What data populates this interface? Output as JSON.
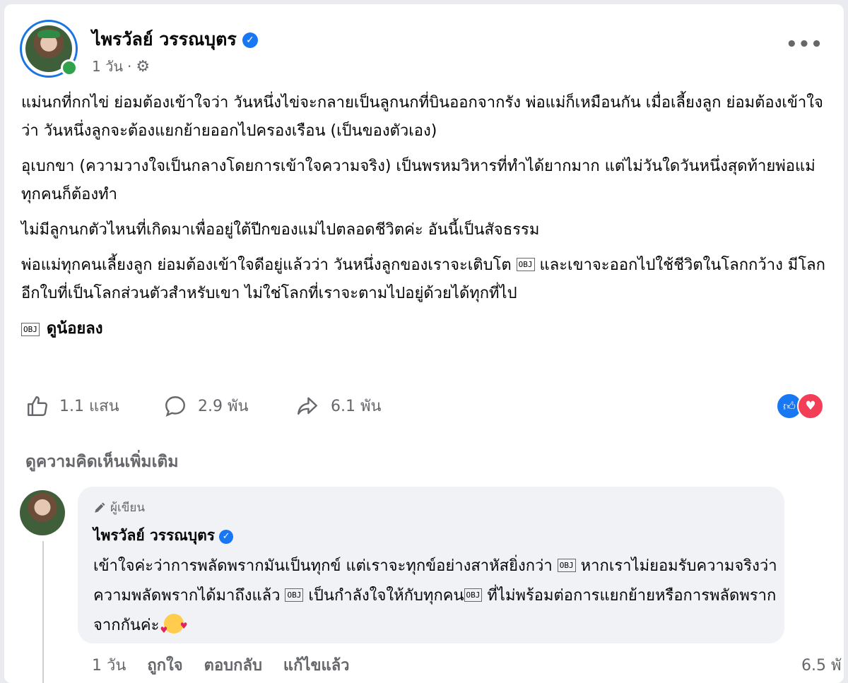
{
  "post": {
    "author": "ไพรวัลย์ วรรณบุตร",
    "time": "1 วัน",
    "meta_separator": "·",
    "more": "•••",
    "paragraphs": {
      "p1": "แม่นกที่กกไข่ ย่อมต้องเข้าใจว่า วันหนึ่งไข่จะกลายเป็นลูกนกที่บินออกจากรัง พ่อแม่ก็เหมือนกัน เมื่อเลี้ยงลูก ย่อมต้องเข้าใจว่า วันหนึ่งลูกจะต้องแยกย้ายออกไปครองเรือน (เป็นของตัวเอง)",
      "p2": "อุเบกขา (ความวางใจเป็นกลางโดยการเข้าใจความจริง) เป็นพรหมวิหารที่ทำได้ยากมาก แต่ไม่วันใดวันหนึ่งสุดท้ายพ่อแม่ทุกคนก็ต้องทำ",
      "p3": "ไม่มีลูกนกตัวไหนที่เกิดมาเพื่ออยู่ใต้ปีกของแม่ไปตลอดชีวิตค่ะ อันนี้เป็นสัจธรรม",
      "p4a": "พ่อแม่ทุกคนเลี้ยงลูก ย่อมต้องเข้าใจดีอยู่แล้วว่า วันหนึ่งลูกของเราจะเติบโต",
      "p4b": "และเขาจะออกไปใช้ชีวิตในโลกกว้าง มีโลกอีกใบที่เป็นโลกส่วนตัวสำหรับเขา ไม่ใช่โลกที่เราจะตามไปอยู่ด้วยได้ทุกที่ไป"
    },
    "obj_glyph": "OBJ",
    "see_less": "ดูน้อยลง"
  },
  "actions": {
    "like_count": "1.1 แสน",
    "comment_count": "2.9 พัน",
    "share_count": "6.1 พัน"
  },
  "more_comments": "ดูความคิดเห็นเพิ่มเติม",
  "comment": {
    "badge": "ผู้เขียน",
    "author": "ไพรวัลย์ วรรณบุตร",
    "t1": "เข้าใจค่ะว่าการพลัดพรากมันเป็นทุกข์ แต่เราจะทุกข์อย่างสาหัสยิ่งกว่า",
    "t2": "หากเราไม่ยอมรับความจริงว่า ความพลัดพรากได้มาถึงแล้ว",
    "t3": "เป็นกำลังใจให้กับทุกคน",
    "t4": "ที่ไม่พร้อมต่อการแยกย้ายหรือการพลัดพรากจากกันค่ะ",
    "time": "1 วัน",
    "like": "ถูกใจ",
    "reply": "ตอบกลับ",
    "edited": "แก้ไขแล้ว",
    "view_count": "6.5 พั"
  },
  "colors": {
    "verified": "#1877f2",
    "secondary_text": "#65676b",
    "bubble": "#f0f2f5",
    "online": "#31a24c",
    "love": "#f33e58"
  }
}
